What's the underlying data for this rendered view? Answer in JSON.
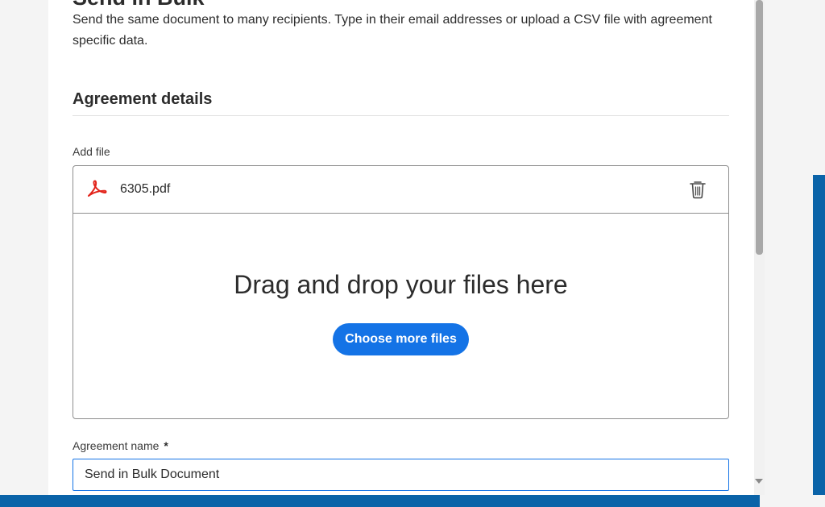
{
  "header": {
    "title": "Send in Bulk",
    "description": "Send the same document to many recipients. Type in their email addresses or upload a CSV file with agreement specific data."
  },
  "agreement_details": {
    "heading": "Agreement details",
    "add_file_label": "Add file",
    "file": {
      "name": "6305.pdf",
      "icon": "pdf-icon",
      "delete_icon": "trash-icon"
    },
    "drop_zone": {
      "text": "Drag and drop your files here",
      "button_label": "Choose more files"
    },
    "agreement_name": {
      "label": "Agreement name",
      "required_marker": "*",
      "value": "Send in Bulk Document"
    }
  },
  "colors": {
    "accent": "#1473e6",
    "pdf_red": "#e2231a",
    "bottom_bar": "#0a63a8"
  }
}
